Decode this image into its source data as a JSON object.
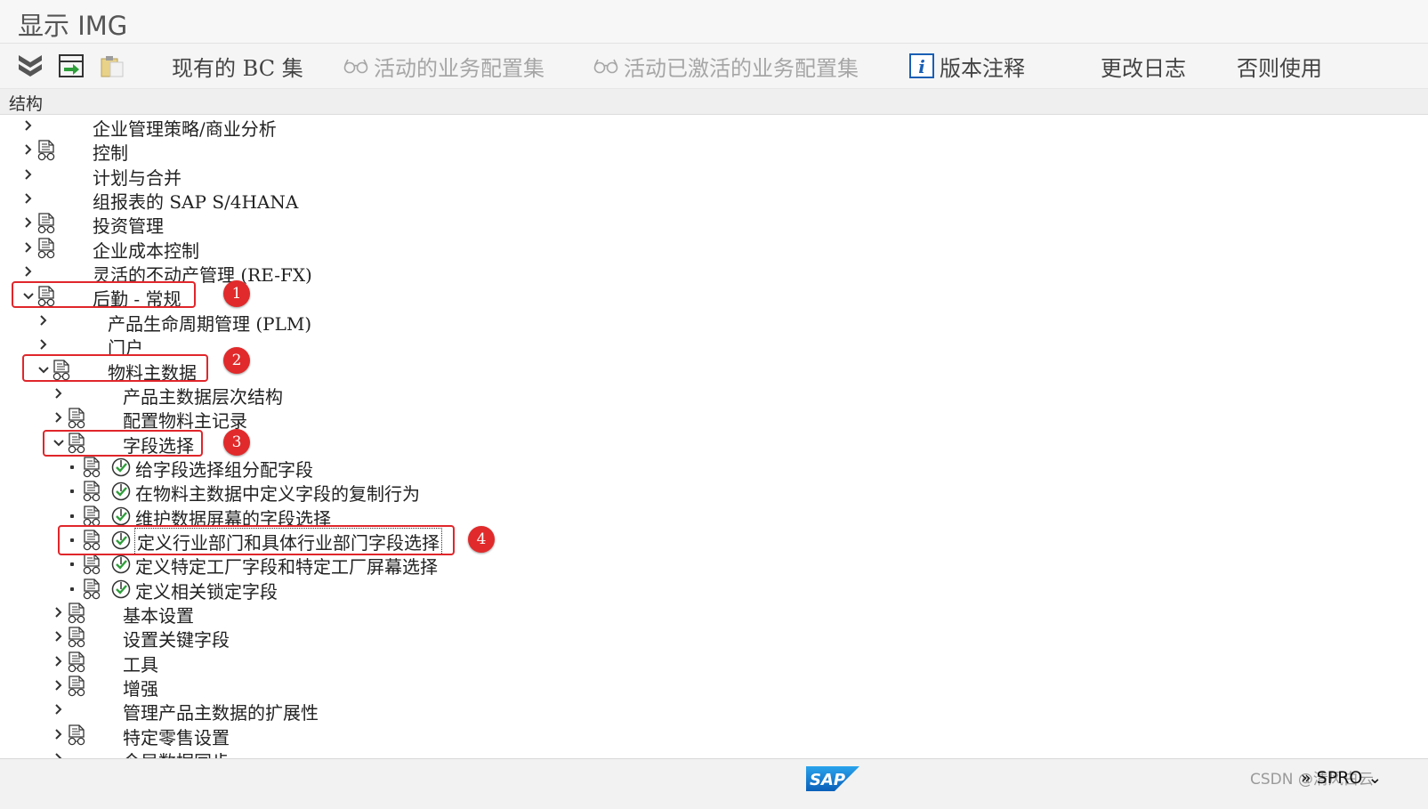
{
  "window": {
    "title": "显示 IMG"
  },
  "toolbar": {
    "existing_bc_sets": "现有的 BC 集",
    "active_bc_sets": "活动的业务配置集",
    "activated_bc_sets": "活动已激活的业务配置集",
    "release_notes": "版本注释",
    "change_log": "更改日志",
    "where_used": "否则使用"
  },
  "section": {
    "title": "结构"
  },
  "tree": {
    "items": [
      {
        "label": "企业管理策略/商业分析"
      },
      {
        "label": "控制"
      },
      {
        "label": "计划与合并"
      },
      {
        "label": "组报表的 SAP S/4HANA"
      },
      {
        "label": "投资管理"
      },
      {
        "label": "企业成本控制"
      },
      {
        "label": "灵活的不动产管理 (RE-FX)"
      },
      {
        "label": "后勤 - 常规"
      },
      {
        "label": "产品生命周期管理 (PLM)"
      },
      {
        "label": "门户"
      },
      {
        "label": "物料主数据"
      },
      {
        "label": "产品主数据层次结构"
      },
      {
        "label": "配置物料主记录"
      },
      {
        "label": "字段选择"
      },
      {
        "label": "给字段选择组分配字段"
      },
      {
        "label": "在物料主数据中定义字段的复制行为"
      },
      {
        "label": "维护数据屏幕的字段选择"
      },
      {
        "label": "定义行业部门和具体行业部门字段选择"
      },
      {
        "label": "定义特定工厂字段和特定工厂屏幕选择"
      },
      {
        "label": "定义相关锁定字段"
      },
      {
        "label": "基本设置"
      },
      {
        "label": "设置关键字段"
      },
      {
        "label": "工具"
      },
      {
        "label": "增强"
      },
      {
        "label": "管理产品主数据的扩展性"
      },
      {
        "label": "特定零售设置"
      },
      {
        "label": "今局数据同步"
      }
    ]
  },
  "annotations": [
    "1",
    "2",
    "3",
    "4"
  ],
  "status": {
    "logo": "SAP",
    "watermark": "CSDN @清风白云",
    "tcode": "SPRO"
  },
  "colors": {
    "highlight": "#e0262b",
    "check": "#2e9e3a",
    "brand": "#1a73c8"
  }
}
